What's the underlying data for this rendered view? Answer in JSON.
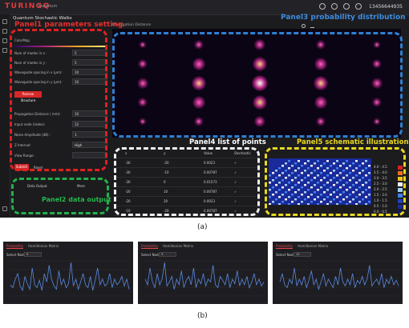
{
  "app": {
    "brand": "TURINGQ",
    "brand_sub": "Quantum",
    "phone": "13456644935",
    "title": "Quantum Stochastic Walks"
  },
  "annotations": {
    "panel1": "Panel1 parameters setting",
    "panel2": "Panel2 data output",
    "panel3": "Panel3 probability distribution",
    "panel4": "Panel4 list of points",
    "panel5": "Panel5 schematic illustrations"
  },
  "params": {
    "colormap_label": "ColorMap",
    "rows": [
      {
        "label": "Num of modes in x :",
        "value": "5"
      },
      {
        "label": "Num of modes in y :",
        "value": "5"
      },
      {
        "label": "Waveguide spacing in x (μm):",
        "value": "10"
      },
      {
        "label": "Waveguide spacing in y (μm):",
        "value": "10"
      }
    ],
    "review_button": "Review Structure",
    "rows2": [
      {
        "label": "Propagation Distance ( mm):",
        "value": "10"
      },
      {
        "label": "Input node (index):",
        "value": "12"
      },
      {
        "label": "Noise Amplitude (dB) :",
        "value": "1"
      },
      {
        "label": "Z Interval:",
        "value": "High"
      },
      {
        "label": "View Range:",
        "value": ""
      }
    ],
    "submit_button": "Submit",
    "reset_button": "Reset"
  },
  "output": {
    "data_output": "Data Output",
    "more": "More"
  },
  "plot": {
    "title": "Propagation Distance"
  },
  "table": {
    "headers": [
      "x",
      "y",
      "Value",
      "Stochastic"
    ],
    "rows": [
      [
        "-30",
        "-20",
        "0.0023",
        "✓"
      ],
      [
        "-30",
        "-10",
        "0.00787",
        "✓"
      ],
      [
        "-30",
        "0",
        "0.01573",
        "✓"
      ],
      [
        "-20",
        "10",
        "0.00787",
        "✓"
      ],
      [
        "-20",
        "20",
        "0.0023",
        "✓"
      ],
      [
        "-10",
        "-20",
        "0.00787",
        "✓"
      ]
    ]
  },
  "legend": {
    "entries": [
      "4.0 - 4.5",
      "3.5 - 4.0",
      "3.0 - 3.5",
      "2.5 - 3.0",
      "2.0 - 2.5",
      "1.5 - 2.0",
      "1.0 - 1.5",
      "0.5 - 1.0",
      "0.0 - 0.5"
    ],
    "colors": [
      "#e02020",
      "#f07020",
      "#f0c020",
      "#f0f0f0",
      "#a0d0f0",
      "#4080f0",
      "#2040c0",
      "#1a2a9a",
      "#101860"
    ]
  },
  "captions": {
    "a": "(a)",
    "b": "(b)"
  },
  "bottom_panels": [
    {
      "tab_active": "Probability",
      "tab_other": "Hamiltonian Matrix",
      "select_label": "Select Node:",
      "select_value": "5",
      "series": [
        0.2,
        0.15,
        0.3,
        0.4,
        0.18,
        0.1,
        0.35,
        0.22,
        0.12,
        0.5,
        0.2,
        0.15,
        0.28,
        0.1,
        0.4,
        0.25,
        0.55,
        0.3,
        0.18,
        0.12,
        0.45,
        0.2,
        0.3,
        0.15,
        0.22,
        0.6,
        0.18,
        0.3,
        0.12,
        0.25,
        0.4,
        0.2,
        0.15,
        0.35,
        0.1,
        0.28,
        0.5,
        0.2,
        0.3,
        0.18,
        0.22,
        0.4,
        0.15,
        0.3,
        0.2,
        0.25,
        0.35,
        0.18,
        0.3,
        0.12
      ]
    },
    {
      "tab_active": "Probability",
      "tab_other": "Hamiltonian Matrix",
      "select_label": "Select Node:",
      "select_value": "3",
      "series": [
        0.3,
        0.2,
        0.5,
        0.25,
        0.15,
        0.4,
        0.2,
        0.3,
        0.6,
        0.18,
        0.25,
        0.35,
        0.12,
        0.3,
        0.2,
        0.45,
        0.15,
        0.28,
        0.35,
        0.2,
        0.5,
        0.15,
        0.3,
        0.22,
        0.4,
        0.18,
        0.3,
        0.25,
        0.55,
        0.2,
        0.15,
        0.35,
        0.28,
        0.2,
        0.4,
        0.15,
        0.3,
        0.22,
        0.45,
        0.18,
        0.3,
        0.2,
        0.35,
        0.15,
        0.25,
        0.4,
        0.2,
        0.3,
        0.18,
        0.25
      ]
    },
    {
      "tab_active": "Probability",
      "tab_other": "Hamiltonian Matrix",
      "select_label": "Select Node:",
      "select_value": "11",
      "series": [
        0.25,
        0.4,
        0.2,
        0.15,
        0.3,
        0.22,
        0.5,
        0.18,
        0.3,
        0.2,
        0.35,
        0.15,
        0.28,
        0.45,
        0.2,
        0.3,
        0.12,
        0.25,
        0.4,
        0.18,
        0.3,
        0.22,
        0.15,
        0.35,
        0.2,
        0.5,
        0.25,
        0.18,
        0.3,
        0.2,
        0.4,
        0.15,
        0.28,
        0.22,
        0.35,
        0.2,
        0.3,
        0.55,
        0.18,
        0.25,
        0.3,
        0.2,
        0.4,
        0.15,
        0.3,
        0.22,
        0.35,
        0.2,
        0.28,
        0.18
      ]
    }
  ]
}
